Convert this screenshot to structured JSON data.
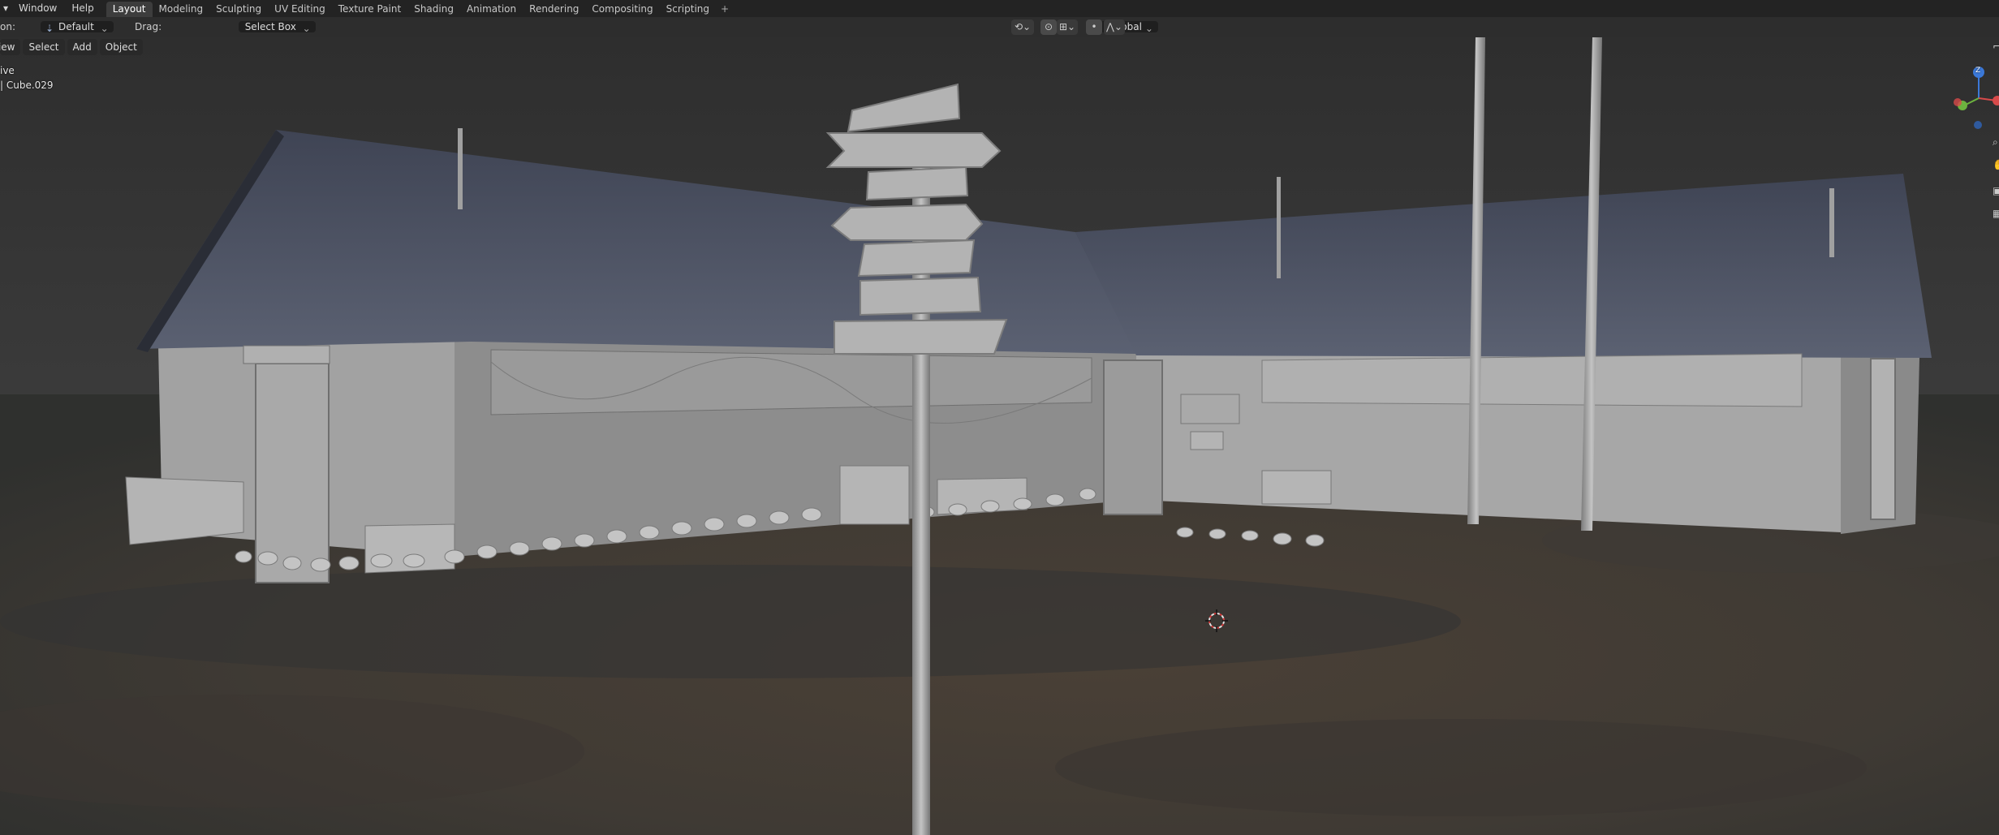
{
  "topbar": {
    "menus": [
      "Window",
      "Help"
    ],
    "workspaces": [
      "Layout",
      "Modeling",
      "Sculpting",
      "UV Editing",
      "Texture Paint",
      "Shading",
      "Animation",
      "Rendering",
      "Compositing",
      "Scripting"
    ],
    "active_workspace": "Layout"
  },
  "header": {
    "orientation_label": "on:",
    "orientation_value": "Default",
    "drag_label": "Drag:",
    "drag_value": "Select Box",
    "transform_orientation": "Global"
  },
  "viewport_menu": [
    "View",
    "Select",
    "Add",
    "Object"
  ],
  "overlay": {
    "view_mode": "ive",
    "object_info": "| Cube.029"
  },
  "gizmo": {
    "z_label": "Z"
  },
  "colors": {
    "sky": "#2f2f2f",
    "ground": "#4a3f35",
    "building": "#a3a3a3",
    "roof": "#4e5466",
    "active_tab": "#3d3d3d"
  }
}
